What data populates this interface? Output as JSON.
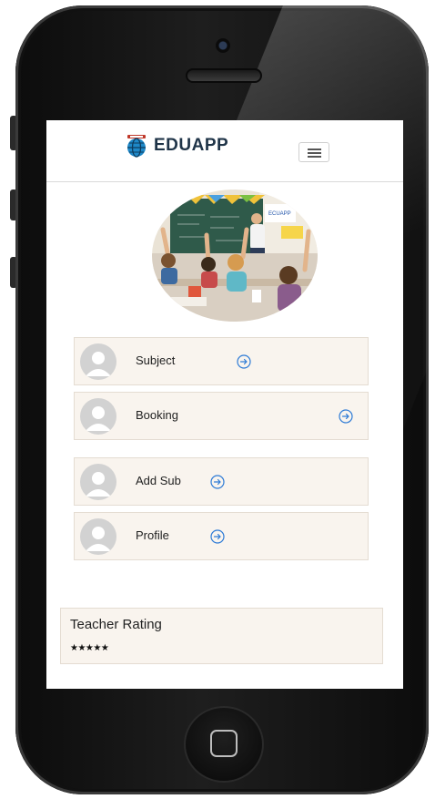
{
  "brand": {
    "name": "EDUAPP"
  },
  "hero": {
    "board_label": "ECUAPP"
  },
  "menu": [
    {
      "label": "Subject"
    },
    {
      "label": "Booking"
    },
    {
      "label": "Add Sub"
    },
    {
      "label": "Profile"
    }
  ],
  "rating": {
    "title": "Teacher Rating",
    "stars": "★★★★★"
  },
  "colors": {
    "accent": "#2e7bd6",
    "card_bg": "#f9f4ee",
    "brand_text": "#1f3448"
  }
}
